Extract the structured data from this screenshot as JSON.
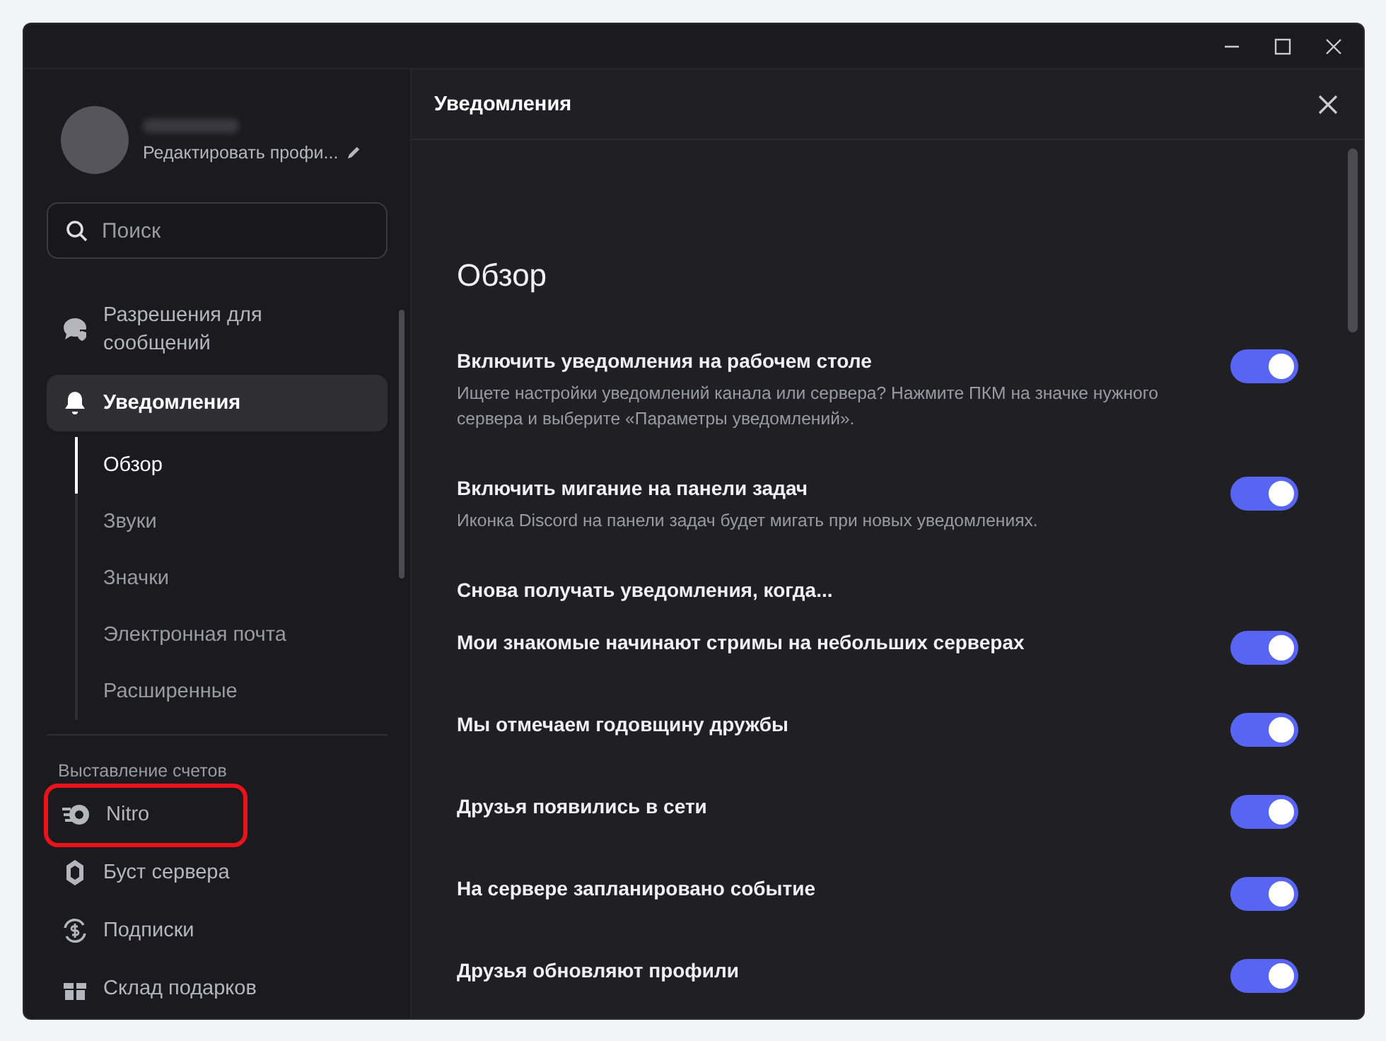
{
  "profile": {
    "edit_label": "Редактировать профи..."
  },
  "search": {
    "placeholder": "Поиск"
  },
  "sidebar": {
    "items": [
      {
        "label": "Разрешения для сообщений",
        "selected": false
      },
      {
        "label": "Уведомления",
        "selected": true,
        "children": [
          {
            "label": "Обзор",
            "selected": true
          },
          {
            "label": "Звуки",
            "selected": false
          },
          {
            "label": "Значки",
            "selected": false
          },
          {
            "label": "Электронная почта",
            "selected": false
          },
          {
            "label": "Расширенные",
            "selected": false
          }
        ]
      }
    ],
    "billing": {
      "heading": "Выставление счетов",
      "items": [
        {
          "label": "Nitro",
          "selected": false,
          "highlighted": true
        },
        {
          "label": "Буст сервера",
          "selected": false,
          "highlighted": false
        },
        {
          "label": "Подписки",
          "selected": false,
          "highlighted": false
        },
        {
          "label": "Склад подарков",
          "selected": false,
          "highlighted": false
        }
      ]
    }
  },
  "panel": {
    "title": "Уведомления",
    "section": "Обзор",
    "rows": [
      {
        "kind": "toggle",
        "label": "Включить уведомления на рабочем столе",
        "description": "Ищете настройки уведомлений канала или сервера? Нажмите ПКМ на значке нужного сервера и выберите «Параметры уведомлений».",
        "on": true
      },
      {
        "kind": "toggle",
        "label": "Включить мигание на панели задач",
        "description": "Иконка Discord на панели задач будет мигать при новых уведомлениях.",
        "on": true
      },
      {
        "kind": "heading",
        "label": "Снова получать уведомления, когда..."
      },
      {
        "kind": "toggle",
        "label": "Мои знакомые начинают стримы на небольших серверах",
        "on": true
      },
      {
        "kind": "toggle",
        "label": "Мы отмечаем годовщину дружбы",
        "on": true
      },
      {
        "kind": "toggle",
        "label": "Друзья появились в сети",
        "on": true
      },
      {
        "kind": "toggle",
        "label": "На сервере запланировано событие",
        "on": true
      },
      {
        "kind": "toggle",
        "label": "Друзья обновляют профили",
        "on": true
      }
    ]
  }
}
